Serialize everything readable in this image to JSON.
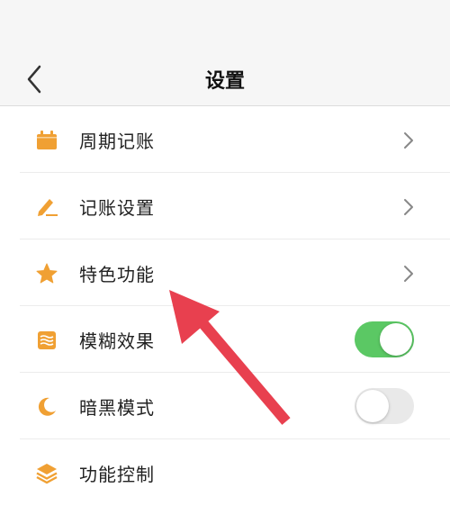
{
  "header": {
    "title": "设置"
  },
  "colors": {
    "accent_orange": "#f0a033",
    "toggle_on": "#5bc864",
    "annotation_arrow": "#e8404f"
  },
  "settings": {
    "items": [
      {
        "label": "周期记账",
        "icon": "calendar-icon",
        "control": "chevron"
      },
      {
        "label": "记账设置",
        "icon": "pen-icon",
        "control": "chevron"
      },
      {
        "label": "特色功能",
        "icon": "star-icon",
        "control": "chevron"
      },
      {
        "label": "模糊效果",
        "icon": "blur-waves-icon",
        "control": "toggle",
        "enabled": true
      },
      {
        "label": "暗黑模式",
        "icon": "moon-icon",
        "control": "toggle",
        "enabled": false
      },
      {
        "label": "功能控制",
        "icon": "layers-icon",
        "control": "none"
      }
    ]
  }
}
